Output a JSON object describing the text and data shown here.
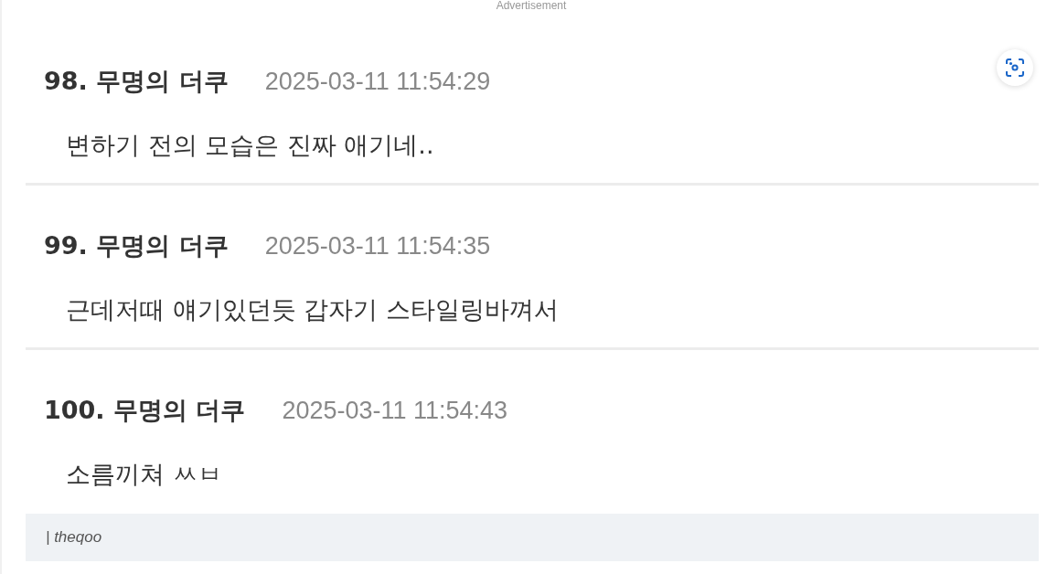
{
  "advertisement": "Advertisement",
  "comments": [
    {
      "number": "98.",
      "author": "무명의 더쿠",
      "time": "2025-03-11 11:54:29",
      "text": "변하기 전의 모습은 진짜 애기네.."
    },
    {
      "number": "99.",
      "author": "무명의 더쿠",
      "time": "2025-03-11 11:54:35",
      "text": "근데저때 얘기있던듯 갑자기 스타일링바껴서"
    },
    {
      "number": "100.",
      "author": "무명의 더쿠",
      "time": "2025-03-11 11:54:43",
      "text": "소름끼쳐 ㅆㅂ"
    }
  ],
  "caption": "| theqoo"
}
